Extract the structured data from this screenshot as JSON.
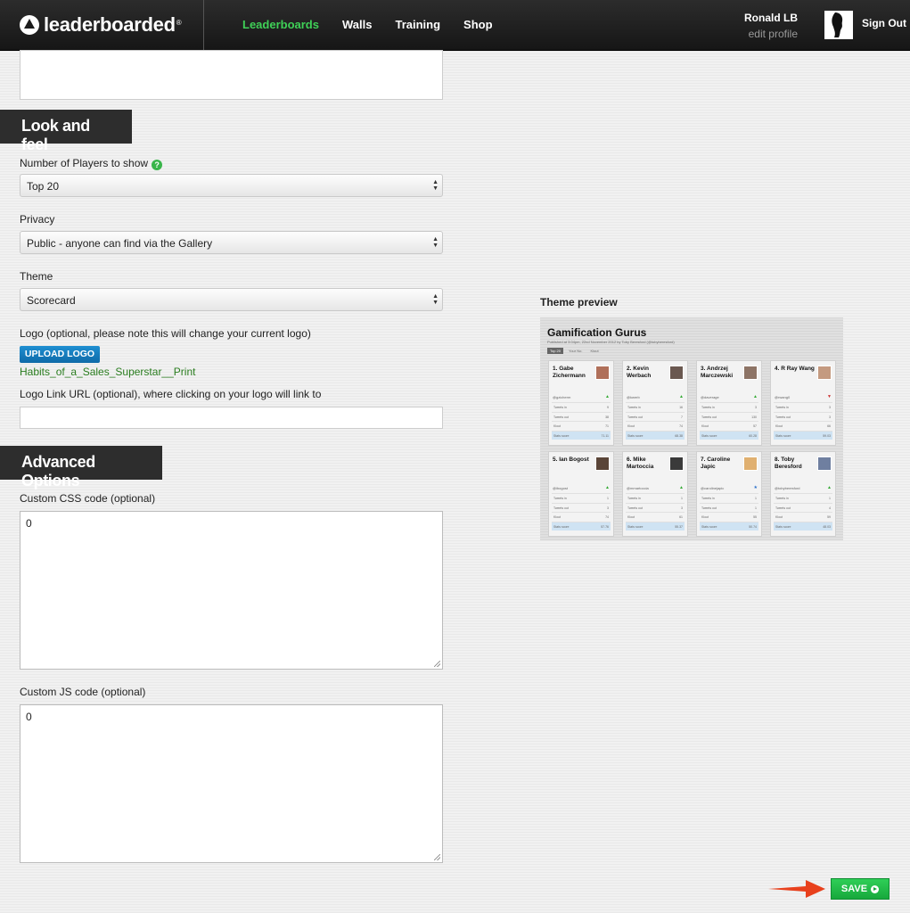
{
  "brand": {
    "name": "leaderboarded",
    "mark": "®"
  },
  "nav": [
    "Leaderboards",
    "Walls",
    "Training",
    "Shop"
  ],
  "user": {
    "name": "Ronald LB",
    "edit": "edit profile",
    "signout": "Sign Out"
  },
  "sections": {
    "look": "Look and feel",
    "advanced": "Advanced Options"
  },
  "fields": {
    "players_label": "Number of Players to show",
    "players_value": "Top 20",
    "privacy_label": "Privacy",
    "privacy_value": "Public - anyone can find via the Gallery",
    "theme_label": "Theme",
    "theme_value": "Scorecard",
    "logo_label": "Logo (optional, please note this will change your current logo)",
    "upload_label": "UPLOAD LOGO",
    "logo_filename": "Habits_of_a_Sales_Superstar__Print",
    "logo_link_label": "Logo Link URL (optional), where clicking on your logo will link to",
    "logo_link_value": "",
    "css_label": "Custom CSS code (optional)",
    "css_value": "0",
    "js_label": "Custom JS code (optional)",
    "js_value": "0"
  },
  "preview": {
    "label": "Theme preview",
    "title": "Gamification Gurus",
    "subtitle": "Published at 3:04pm, 22nd November 2012 by Toby Beresford (@tobyberesford)",
    "tabs": [
      "Top 20",
      "Your No.",
      "Klout"
    ],
    "row_labels": [
      "Tweets in",
      "Tweets out",
      "Klout",
      "Stats score"
    ],
    "cards": [
      {
        "name": "1. Gabe Zichermann",
        "handle": "@gzicherm",
        "trend": "▲",
        "vals": [
          "9",
          "38",
          "71",
          "71.11"
        ]
      },
      {
        "name": "2. Kevin Werbach",
        "handle": "@kwerb",
        "trend": "▲",
        "vals": [
          "16",
          "7",
          "74",
          "68.38"
        ]
      },
      {
        "name": "3. Andrzej Marczewski",
        "handle": "@daverage",
        "trend": "▲",
        "vals": [
          "3",
          "130",
          "57",
          "60.28"
        ]
      },
      {
        "name": "4. R Ray Wang",
        "handle": "@rwang0",
        "trend": "▼",
        "vals": [
          "3",
          "3",
          "66",
          "59.03"
        ]
      },
      {
        "name": "5. Ian Bogost",
        "handle": "@ibogost",
        "trend": "▲",
        "vals": [
          "1",
          "3",
          "74",
          "57.76"
        ]
      },
      {
        "name": "6. Mike Martoccia",
        "handle": "@mmartoccia",
        "trend": "▲",
        "vals": [
          "1",
          "3",
          "61",
          "55.37"
        ]
      },
      {
        "name": "7. Caroline Japic",
        "handle": "@carolinejapic",
        "trend": "★",
        "vals": [
          "1",
          "1",
          "55",
          "50.74"
        ]
      },
      {
        "name": "8. Toby Beresford",
        "handle": "@tobyberesford",
        "trend": "▲",
        "vals": [
          "1",
          "4",
          "59",
          "48.03"
        ]
      }
    ]
  },
  "save_label": "SAVE",
  "colors": {
    "accent_green": "#3fd057",
    "save_green": "#1fbf48",
    "upload_blue": "#1581c4",
    "arrow_red": "#e8401c"
  }
}
